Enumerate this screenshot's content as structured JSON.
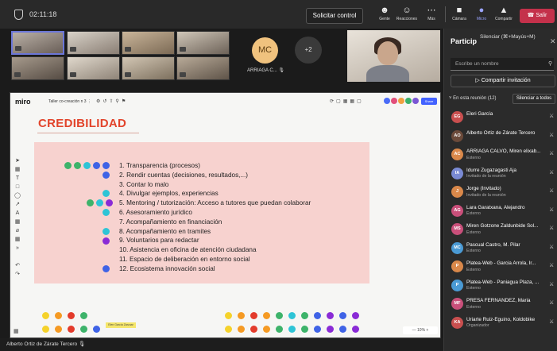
{
  "topbar": {
    "timer": "02:11:18",
    "request_control": "Solicitar control",
    "tools": [
      {
        "label": "Gente",
        "icon": "people-icon"
      },
      {
        "label": "Reacciones",
        "icon": "reactions-icon"
      },
      {
        "label": "Más",
        "icon": "more-icon"
      },
      {
        "label": "Cámara",
        "icon": "camera-icon"
      },
      {
        "label": "Micro",
        "icon": "mic-icon"
      },
      {
        "label": "Compartir",
        "icon": "share-icon"
      }
    ],
    "leave": "Salir"
  },
  "videos": {
    "mc_initials": "MC",
    "mc_name": "ARRIAGA C...",
    "overflow": "+2"
  },
  "miro": {
    "logo": "miro",
    "board_name": "Taller co-creación n 3",
    "share": "Share",
    "heading": "CREDIBILIDAD",
    "items": [
      "1. Transparencia (procesos)",
      "2. Rendir cuentas (decisiones, resultados,...)",
      "3. Contar lo malo",
      "4. Divulgar ejemplos, experiencias",
      "5. Mentoring / tutorización: Acceso a tutores que puedan colaborar",
      "6. Asesoramiento jurídico",
      "7. Acompañamiento en financiación",
      "8. Acompañamiento en tramites",
      "9. Voluntarios para redactar",
      "10. Asistencia en oficina de atención ciudadana",
      "11. Espacio de deliberación en entorno social",
      "12. Ecosistema innovación social"
    ],
    "note": "Elen García Zarzuar",
    "zoom": "— 10% +"
  },
  "participants": {
    "title": "Particip",
    "tooltip": "Silenciar (⌘+Mayús+M)",
    "search_placeholder": "Escribe un nombre",
    "invite": "Compartir invitación",
    "in_meeting": "En esta reunión (12)",
    "mute_all": "Silenciar a todos",
    "list": [
      {
        "initials": "EG",
        "name": "Eleri García",
        "sub": "",
        "color": "#c94f4f"
      },
      {
        "initials": "AO",
        "name": "Alberto Ortiz de Zárate Tercero",
        "sub": "",
        "color": "#6b4a3a"
      },
      {
        "initials": "AC",
        "name": "ARRIAGA CALVO, Miren elixab...",
        "sub": "Externo",
        "color": "#d9884a"
      },
      {
        "initials": "IA",
        "name": "Idurre Zugazagasti Aja",
        "sub": "Invitado de la reunión",
        "color": "#7a8ad4"
      },
      {
        "initials": "J",
        "name": "Jorge (Invitado)",
        "sub": "Invitado de la reunión",
        "color": "#d9884a"
      },
      {
        "initials": "AG",
        "name": "Lara Garatxana, Alejandro",
        "sub": "Externo",
        "color": "#c94f7a"
      },
      {
        "initials": "MS",
        "name": "Miren Gotzone Zaldunbide Sol...",
        "sub": "Externo",
        "color": "#c94f7a"
      },
      {
        "initials": "MC",
        "name": "Pascual Castro, M. Pilar",
        "sub": "Externo",
        "color": "#4a9ad4"
      },
      {
        "initials": "P",
        "name": "Platea-Web - Garcia Arrola, Ir...",
        "sub": "Externo",
        "color": "#d9884a"
      },
      {
        "initials": "P",
        "name": "Platea-Web - Paniagua Plaza, ...",
        "sub": "Externo",
        "color": "#4a9ad4"
      },
      {
        "initials": "MF",
        "name": "PRESA FERNANDEZ, Maria",
        "sub": "Externo",
        "color": "#c94f7a"
      },
      {
        "initials": "KA",
        "name": "Uriarte Ruiz-Eguino, Koldobike",
        "sub": "Organizador",
        "color": "#c94f4f"
      }
    ]
  },
  "bottom": {
    "name": "Alberto Ortiz de Zárate Tercero"
  }
}
